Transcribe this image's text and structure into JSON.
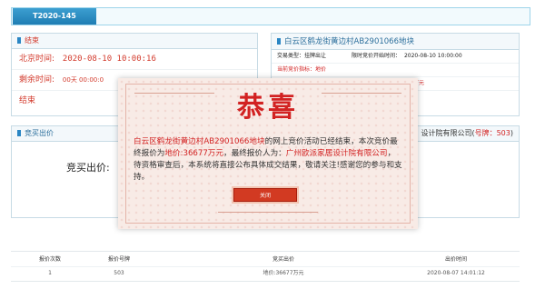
{
  "header": {
    "code": "T2020-145"
  },
  "status_panel": {
    "title": "结束",
    "beijing_time_label": "北京时间:",
    "beijing_time_value": "2020-08-10  10:00:16",
    "remaining_label": "剩余时间:",
    "remaining_value": "00天  00:00:0",
    "state": "结束"
  },
  "lot_panel": {
    "title": "白云区鹤龙街黄边村AB2901066地块",
    "trade_type_label": "交易类型：",
    "trade_type_value": "挂牌出让",
    "deadline_label": "限时竞价开始时间：",
    "deadline_value": "2020-08-10  10:00:00",
    "indicator_label": "当前竞价指标：",
    "indicator_value": "地价",
    "price_fragment": "万元"
  },
  "bid_panel": {
    "title": "竞买出价",
    "bid_label": "竞买出价:",
    "bidder_fragment": "设计院有限公司(",
    "bid_no_label": "号牌：",
    "bid_no": "503",
    "bidder_close": ")"
  },
  "bid_table": {
    "columns": [
      "报价次数",
      "报价号牌",
      "竞买出价",
      "出价时间"
    ],
    "rows": [
      {
        "count": "1",
        "plate": "503",
        "price": "地价:36677万元",
        "time": "2020-08-07  14:01:12"
      }
    ]
  },
  "popup": {
    "heading": "恭喜",
    "lot_name": "白云区鹤龙街黄边村AB2901066地块",
    "text_1": "的网上竞价活动已经结束，本次竞价最终报价为",
    "final_price": "地价:36677万元",
    "text_2": "，最终报价人为：",
    "winner": "广州欧派家居设计院有限公司",
    "text_3": "，待资格审查后，本系统将直接公布具体成交结果，敬请关注!感谢您的参与和支持。",
    "close_label": "关闭"
  },
  "colors": {
    "accent": "#2a86c4",
    "alert_red": "#d22222",
    "popup_bg": "#f8ebe6"
  }
}
